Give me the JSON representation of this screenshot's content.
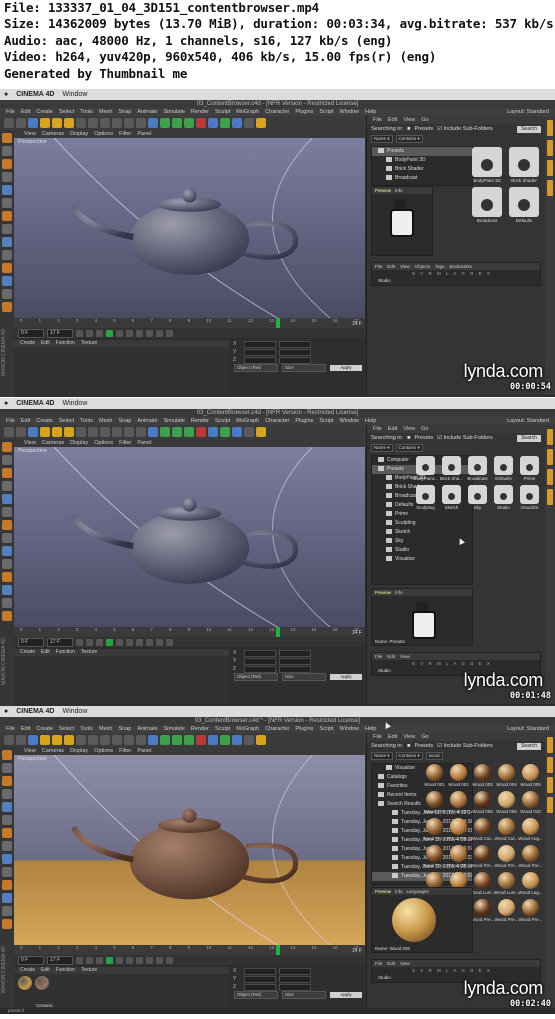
{
  "header": {
    "file": "File: 133337_01_04_3D151_contentbrowser.mp4",
    "size": "Size: 14362009 bytes (13.70 MiB), duration: 00:03:34, avg.bitrate: 537 kb/s",
    "audio": "Audio: aac, 48000 Hz, 1 channels, s16, 127 kb/s (eng)",
    "video": "Video: h264, yuv420p, 960x540, 406 kb/s, 15.00 fps(r) (eng)",
    "generated": "Generated by Thumbnail me"
  },
  "frames": [
    {
      "os_menu": [
        "CINEMA 4D",
        "Window"
      ],
      "title": "03_ContentBrowser.c4d - [NFR Version - Restricted License]",
      "app_menu": [
        "File",
        "Edit",
        "Create",
        "Select",
        "Tools",
        "Mesh",
        "Snap",
        "Animate",
        "Simulate",
        "Render",
        "Sculpt",
        "MoGraph",
        "Character",
        "Plugins",
        "Script",
        "Window",
        "Help"
      ],
      "layout_label": "Layout:",
      "layout_value": "Standard",
      "viewport_menu": [
        "View",
        "Cameras",
        "Display",
        "Options",
        "Filter",
        "Panel"
      ],
      "viewport_label": "Perspective",
      "frame_field": "0 F",
      "end_field": "17 F",
      "current_frame": "14 F",
      "materials_menu": [
        "Create",
        "Edit",
        "Function",
        "Texture"
      ],
      "object_dropdown": "Object (Rel)",
      "size_dropdown": "Size",
      "apply_label": "Apply",
      "cb_menu": [
        "File",
        "Edit",
        "View",
        "Go"
      ],
      "searching_in": "Searching in:",
      "search_path": "Presets",
      "include_subfolders": "Include Sub-Folders",
      "search_button": "Search",
      "filter_name": "Name",
      "filter_contains": "Contains",
      "tree": [
        {
          "label": "Presets",
          "sel": true,
          "level": 0
        },
        {
          "label": "BodyPaint 3D",
          "sel": false,
          "level": 1
        },
        {
          "label": "Brick Shader",
          "sel": false,
          "level": 1
        },
        {
          "label": "Broadcast",
          "sel": false,
          "level": 1
        }
      ],
      "grid_items": [
        "BodyPaint 3D",
        "Brick Shader",
        "Broadcast",
        "Defaults"
      ],
      "preview_tabs": [
        "Preview",
        "Info"
      ],
      "obj_menu": [
        "File",
        "Edit",
        "View",
        "Objects",
        "Tags",
        "Bookmarks"
      ],
      "obj_row": "Studio",
      "obj_cols": "S V R M L A G D E X",
      "statusbar": "",
      "timestamp": "00:00:54",
      "lynda": "lynda.com"
    },
    {
      "os_menu": [
        "CINEMA 4D",
        "Window"
      ],
      "title": "03_ContentBrowser.c4d - [NFR Version - Restricted License]",
      "app_menu": [
        "File",
        "Edit",
        "Create",
        "Select",
        "Tools",
        "Mesh",
        "Snap",
        "Animate",
        "Simulate",
        "Render",
        "Sculpt",
        "MoGraph",
        "Character",
        "Plugins",
        "Script",
        "Window",
        "Help"
      ],
      "layout_label": "Layout:",
      "layout_value": "Standard",
      "viewport_menu": [
        "View",
        "Cameras",
        "Display",
        "Options",
        "Filter",
        "Panel"
      ],
      "viewport_label": "Perspective",
      "frame_field": "0 F",
      "end_field": "17 F",
      "current_frame": "14 F",
      "materials_menu": [
        "Create",
        "Edit",
        "Function",
        "Texture"
      ],
      "object_dropdown": "Object (Rel)",
      "size_dropdown": "Size",
      "apply_label": "Apply",
      "cb_menu": [
        "File",
        "Edit",
        "View",
        "Go"
      ],
      "searching_in": "Searching in:",
      "search_path": "Presets",
      "include_subfolders": "Include Sub-Folders",
      "search_button": "Search",
      "filter_name": "Name",
      "filter_contains": "Contains",
      "tree": [
        {
          "label": "Computer",
          "sel": false,
          "level": 0
        },
        {
          "label": "Presets",
          "sel": true,
          "level": 0
        },
        {
          "label": "BodyPaint 3D",
          "sel": false,
          "level": 1
        },
        {
          "label": "Brick Shader",
          "sel": false,
          "level": 1
        },
        {
          "label": "Broadcast",
          "sel": false,
          "level": 1
        },
        {
          "label": "Defaults",
          "sel": false,
          "level": 1
        },
        {
          "label": "Prime",
          "sel": false,
          "level": 1
        },
        {
          "label": "Sculpting",
          "sel": false,
          "level": 1
        },
        {
          "label": "Sketch",
          "sel": false,
          "level": 1
        },
        {
          "label": "Sky",
          "sel": false,
          "level": 1
        },
        {
          "label": "Studio",
          "sel": false,
          "level": 1
        },
        {
          "label": "Visualize",
          "sel": false,
          "level": 1
        }
      ],
      "grid_items": [
        "BodyPaint...",
        "Brick Sha...",
        "Broadcast",
        "Defaults",
        "Prime",
        "Sculpting",
        "Sketch",
        "Sky",
        "Studio",
        "Visualize"
      ],
      "preview_tabs": [
        "Preview",
        "Info"
      ],
      "name_line": "Name: Presets",
      "obj_menu": [
        "File",
        "Edit",
        "View"
      ],
      "obj_row": "Studio",
      "obj_cols": "S V R M L A G D E X",
      "statusbar": "",
      "timestamp": "00:01:48",
      "lynda": "lynda.com"
    },
    {
      "os_menu": [
        "CINEMA 4D",
        "Window"
      ],
      "title": "03_ContentBrowser.c4d * - [NFR Version - Restricted License]",
      "app_menu": [
        "File",
        "Edit",
        "Create",
        "Select",
        "Tools",
        "Mesh",
        "Snap",
        "Animate",
        "Simulate",
        "Render",
        "Sculpt",
        "MoGraph",
        "Character",
        "Plugins",
        "Script",
        "Window",
        "Help"
      ],
      "layout_label": "Layout:",
      "layout_value": "Standard",
      "viewport_menu": [
        "View",
        "Cameras",
        "Display",
        "Options",
        "Filter",
        "Panel"
      ],
      "viewport_label": "Perspective",
      "frame_field": "0 F",
      "end_field": "17 F",
      "current_frame": "14 F",
      "materials_menu": [
        "Create",
        "Edit",
        "Function",
        "Texture"
      ],
      "material_name": "Ceramic",
      "object_dropdown": "Object (Rel)",
      "size_dropdown": "Size",
      "apply_label": "Apply",
      "cb_menu": [
        "File",
        "Edit",
        "View",
        "Go"
      ],
      "searching_in": "Searching in:",
      "search_path": "Presets",
      "include_subfolders": "Include Sub-Folders",
      "search_button": "Search",
      "filter_name": "Name",
      "filter_contains": "Contains",
      "filter_value": "wood",
      "tree": [
        {
          "label": "Visualize",
          "sel": false,
          "level": 1
        },
        {
          "label": "Catalogs",
          "sel": false,
          "level": 0
        },
        {
          "label": "Favorites",
          "sel": false,
          "level": 0
        },
        {
          "label": "Recent Items",
          "sel": false,
          "level": 0
        },
        {
          "label": "Search Results",
          "sel": false,
          "level": 0
        },
        {
          "label": "Tuesday, June 11, 2013, 4:12:34 PM",
          "sel": false,
          "level": 2
        },
        {
          "label": "Tuesday, June 11, 2013, 4:14:38 PM",
          "sel": false,
          "level": 2
        },
        {
          "label": "Tuesday, June 11, 2013, 4:15:01 PM",
          "sel": false,
          "level": 2
        },
        {
          "label": "Tuesday, June 11, 2013, 4:15:28 PM",
          "sel": false,
          "level": 2
        },
        {
          "label": "Tuesday, June 11, 2013, 4:16:07 PM",
          "sel": false,
          "level": 2
        },
        {
          "label": "Tuesday, June 11, 2013, 4:21:23 PM",
          "sel": false,
          "level": 2
        },
        {
          "label": "Tuesday, June 11, 2013, 4:25:06 PM",
          "sel": false,
          "level": 2
        },
        {
          "label": "Tuesday, June 11, 2013, 4:26:07 PM",
          "sel": true,
          "level": 2
        }
      ],
      "grid_items": [
        "Wood 001",
        "Wood 002",
        "Wood 003",
        "Wood 004",
        "Wood 005",
        "Wood 006",
        "Wood 007",
        "Wood 008",
        "Wood 009",
        "Wood 010",
        "Wood Pre...",
        "Wood Pre...",
        "Wood Cut...",
        "Wood Cut...",
        "Wood Aug...",
        "Wood Pre...",
        "Wood Cer...",
        "Wood Pre...",
        "Wood Pre...",
        "Wood Pre...",
        "Wood Aug...",
        "Wood NCV",
        "Wood Lum...",
        "Wood Lum...",
        "Wood Lag...",
        "Wood Ora...",
        "Wood Par...",
        "Wood Pre...",
        "Wood Pre...",
        "Wood Pre..."
      ],
      "wood_colors": [
        "#8a5a2b",
        "#b77a3c",
        "#6d3e1c",
        "#9a6a35",
        "#c4924f",
        "#7b4a24",
        "#a86f3b",
        "#5e3419",
        "#d0a56a",
        "#8f5f2e"
      ],
      "preview_tabs": [
        "Preview",
        "Info",
        "Languages"
      ],
      "name_line": "Name: Wood 006",
      "obj_menu": [
        "File",
        "Edit",
        "View"
      ],
      "obj_row": "Studio",
      "obj_cols": "S V R M L A G D E X",
      "statusbar": "preset://",
      "timestamp": "00:02:40",
      "lynda": "lynda.com"
    }
  ]
}
